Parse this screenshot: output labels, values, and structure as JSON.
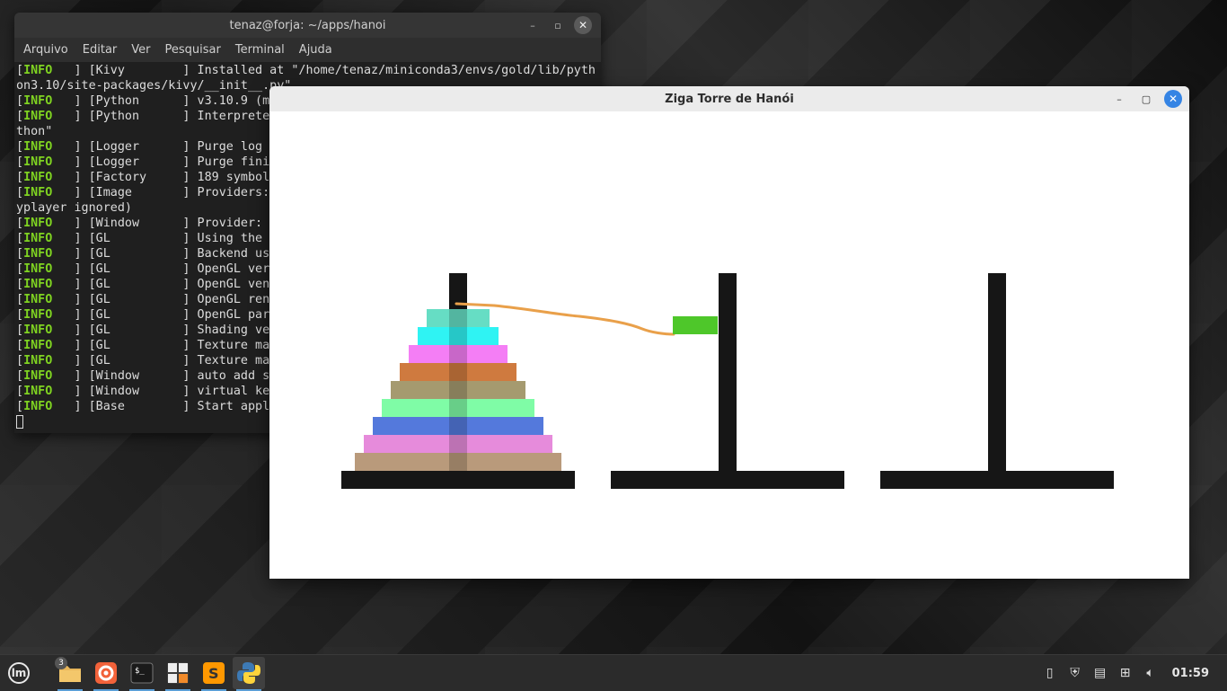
{
  "terminal": {
    "title": "tenaz@forja: ~/apps/hanoi",
    "menu": [
      "Arquivo",
      "Editar",
      "Ver",
      "Pesquisar",
      "Terminal",
      "Ajuda"
    ],
    "lines": [
      {
        "tag": "INFO",
        "rest": "   ] [Kivy        ] Installed at \"/home/tenaz/miniconda3/envs/gold/lib/pyth"
      },
      {
        "tag": "",
        "rest": "on3.10/site-packages/kivy/__init__.py\""
      },
      {
        "tag": "INFO",
        "rest": "   ] [Python      ] v3.10.9 (ma"
      },
      {
        "tag": "INFO",
        "rest": "   ] [Python      ] Interpreter"
      },
      {
        "tag": "",
        "rest": "thon\""
      },
      {
        "tag": "INFO",
        "rest": "   ] [Logger      ] Purge log f"
      },
      {
        "tag": "INFO",
        "rest": "   ] [Logger      ] Purge finis"
      },
      {
        "tag": "INFO",
        "rest": "   ] [Factory     ] 189 symbols"
      },
      {
        "tag": "INFO",
        "rest": "   ] [Image       ] Providers: "
      },
      {
        "tag": "",
        "rest": "yplayer ignored)"
      },
      {
        "tag": "INFO",
        "rest": "   ] [Window      ] Provider: s"
      },
      {
        "tag": "INFO",
        "rest": "   ] [GL          ] Using the \""
      },
      {
        "tag": "INFO",
        "rest": "   ] [GL          ] Backend use"
      },
      {
        "tag": "INFO",
        "rest": "   ] [GL          ] OpenGL vers"
      },
      {
        "tag": "INFO",
        "rest": "   ] [GL          ] OpenGL vend"
      },
      {
        "tag": "INFO",
        "rest": "   ] [GL          ] OpenGL rend"
      },
      {
        "tag": "INFO",
        "rest": "   ] [GL          ] OpenGL pars"
      },
      {
        "tag": "INFO",
        "rest": "   ] [GL          ] Shading ver"
      },
      {
        "tag": "INFO",
        "rest": "   ] [GL          ] Texture max"
      },
      {
        "tag": "INFO",
        "rest": "   ] [GL          ] Texture max"
      },
      {
        "tag": "INFO",
        "rest": "   ] [Window      ] auto add sd"
      },
      {
        "tag": "INFO",
        "rest": "   ] [Window      ] virtual key"
      },
      {
        "tag": "INFO",
        "rest": "   ] [Base        ] Start appli"
      }
    ]
  },
  "game": {
    "title": "Ziga Torre de Hanói",
    "disk_colors_top_to_bottom": [
      "#66ddc4",
      "#2ff3f3",
      "#f47ef5",
      "#cf7a3f",
      "#a59a6f",
      "#7ffca6",
      "#5479dc",
      "#e68bdb",
      "#b99a7b"
    ],
    "moving_disk_color": "#4ec72a",
    "cable_color": "#e9a04a",
    "peg_color": "#161616"
  },
  "taskbar": {
    "apps": [
      {
        "name": "files",
        "badge": "3"
      },
      {
        "name": "firefox"
      },
      {
        "name": "terminal"
      },
      {
        "name": "calculator"
      },
      {
        "name": "sublime-text"
      },
      {
        "name": "python"
      }
    ],
    "clock": "01:59"
  }
}
